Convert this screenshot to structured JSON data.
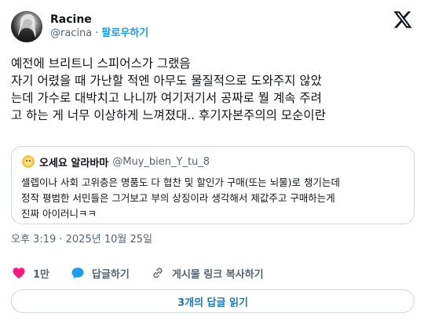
{
  "author": {
    "display_name": "Racine",
    "handle": "@racina",
    "separator": "·",
    "follow_label": "팔로우하기"
  },
  "tweet": {
    "text": "예전에 브리트니 스피어스가 그랬음\n자기 어렸을 때 가난할 적엔 아무도 물질적으로 도와주지 않았\n는데 가수로 대박치고 나니까 여기저기서 공짜로 뭘 계속 주려\n고 하는 게 너무 이상하게 느껴졌대.. 후기자본주의의 모순이란",
    "timestamp": "오후 3:19 · 2025년 10월 25일"
  },
  "quote": {
    "author_name": "오세요 알라바마",
    "author_handle": "@Muy_bien_Y_tu_8",
    "text": "셀렙이나 사회 고위층은 명품도 다 협찬 및 할인가 구매(또는 뇌물)로 챙기는데\n정작 평범한 서민들은 그거보고 부의 상징이라 생각해서 제값주고 구매하는게\n진짜 아이러니ㅋㅋ"
  },
  "actions": {
    "like_count": "1만",
    "reply_label": "답글하기",
    "copy_link_label": "게시물 링크 복사하기"
  },
  "replies_button": "3개의 답글 읽기",
  "icons": {
    "like": "heart-icon",
    "reply": "reply-bubble-icon",
    "link": "link-icon",
    "brand": "x-logo-icon"
  },
  "colors": {
    "like": "#f91880",
    "reply": "#1d9bf0",
    "link": "#536471",
    "follow": "#1d9bf0",
    "replies_button_text": "#1d77c9"
  }
}
